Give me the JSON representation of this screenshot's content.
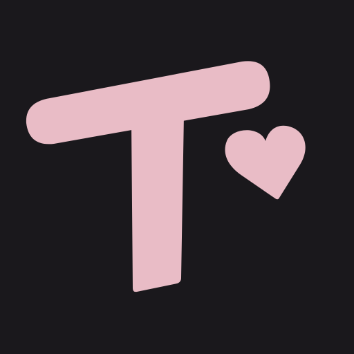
{
  "logo": {
    "letter": "T",
    "icon": "heart-icon",
    "colors": {
      "background": "#1a181c",
      "foreground": "#e9bcc6"
    }
  }
}
